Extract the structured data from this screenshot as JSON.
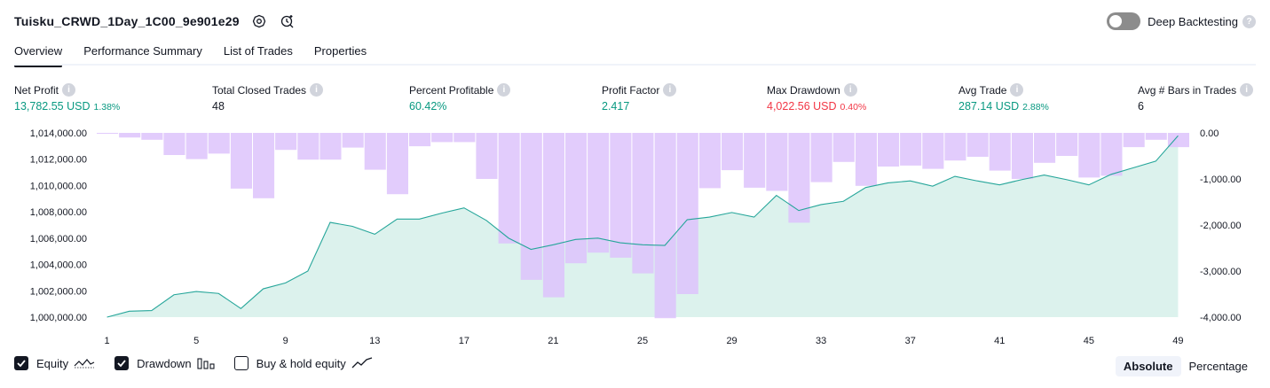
{
  "header": {
    "strategy_name": "Tuisku_CRWD_1Day_1C00_9e901e29",
    "deep_backtesting_label": "Deep Backtesting",
    "deep_backtesting_enabled": false
  },
  "tabs": [
    {
      "label": "Overview",
      "active": true
    },
    {
      "label": "Performance Summary",
      "active": false
    },
    {
      "label": "List of Trades",
      "active": false
    },
    {
      "label": "Properties",
      "active": false
    }
  ],
  "metrics": [
    {
      "label": "Net Profit",
      "value": "13,782.55 USD",
      "pct": "1.38%",
      "color": "green"
    },
    {
      "label": "Total Closed Trades",
      "value": "48",
      "pct": "",
      "color": "default"
    },
    {
      "label": "Percent Profitable",
      "value": "60.42%",
      "pct": "",
      "color": "green"
    },
    {
      "label": "Profit Factor",
      "value": "2.417",
      "pct": "",
      "color": "green"
    },
    {
      "label": "Max Drawdown",
      "value": "4,022.56 USD",
      "pct": "0.40%",
      "color": "red"
    },
    {
      "label": "Avg Trade",
      "value": "287.14 USD",
      "pct": "2.88%",
      "color": "green"
    },
    {
      "label": "Avg # Bars in Trades",
      "value": "6",
      "pct": "",
      "color": "default"
    }
  ],
  "colors": {
    "equity_line": "#26a69a",
    "equity_fill": "#d6f0ea",
    "drawdown_bar": "#ddc3fb",
    "green": "#089981",
    "red": "#f23645"
  },
  "chart_data": {
    "type": "area",
    "x": [
      1,
      2,
      3,
      4,
      5,
      6,
      7,
      8,
      9,
      10,
      11,
      12,
      13,
      14,
      15,
      16,
      17,
      18,
      19,
      20,
      21,
      22,
      23,
      24,
      25,
      26,
      27,
      28,
      29,
      30,
      31,
      32,
      33,
      34,
      35,
      36,
      37,
      38,
      39,
      40,
      41,
      42,
      43,
      44,
      45,
      46,
      47,
      48,
      49
    ],
    "x_ticks": [
      "1",
      "5",
      "9",
      "13",
      "17",
      "21",
      "25",
      "29",
      "33",
      "37",
      "41",
      "45",
      "49"
    ],
    "series": [
      {
        "name": "Equity",
        "axis": "left",
        "values": [
          1000000,
          1000450,
          1000500,
          1001700,
          1001950,
          1001800,
          1000650,
          1002150,
          1002600,
          1003500,
          1007200,
          1006900,
          1006300,
          1007450,
          1007450,
          1007900,
          1008300,
          1007350,
          1006000,
          1005150,
          1005500,
          1005900,
          1006000,
          1005650,
          1005500,
          1005450,
          1007400,
          1007600,
          1007950,
          1007600,
          1009250,
          1008100,
          1008550,
          1008800,
          1009850,
          1010200,
          1010350,
          1009950,
          1010700,
          1010350,
          1010050,
          1010450,
          1010800,
          1010450,
          1010050,
          1010850,
          1011350,
          1011850,
          1013782.55
        ]
      },
      {
        "name": "Drawdown",
        "axis": "right",
        "values": [
          0,
          -100,
          -150,
          -480,
          -570,
          -450,
          -1210,
          -1420,
          -370,
          -580,
          -580,
          -320,
          -800,
          -1330,
          -290,
          -200,
          -200,
          -1000,
          -2400,
          -3190,
          -3570,
          -2830,
          -2600,
          -2710,
          -3050,
          -4022.56,
          -3500,
          -1200,
          -810,
          -1190,
          -1260,
          -1950,
          -1070,
          -630,
          -1150,
          -730,
          -710,
          -780,
          -600,
          -520,
          -820,
          -1000,
          -650,
          -500,
          -970,
          -930,
          -310,
          -150,
          -310
        ]
      }
    ],
    "ylim_left": [
      1000000,
      1014000
    ],
    "ylim_right": [
      -4000,
      0
    ],
    "y_ticks_left": [
      "1,000,000.00",
      "1,002,000.00",
      "1,004,000.00",
      "1,006,000.00",
      "1,008,000.00",
      "1,010,000.00",
      "1,012,000.00",
      "1,014,000.00"
    ],
    "y_ticks_right": [
      "0.00",
      "-1,000.00",
      "-2,000.00",
      "-3,000.00",
      "-4,000.00"
    ]
  },
  "footer": {
    "checkboxes": [
      {
        "label": "Equity",
        "checked": true,
        "icon": "equity-line-icon"
      },
      {
        "label": "Drawdown",
        "checked": true,
        "icon": "drawdown-bars-icon"
      },
      {
        "label": "Buy & hold equity",
        "checked": false,
        "icon": "buy-hold-line-icon"
      }
    ],
    "modes": [
      {
        "label": "Absolute",
        "active": true
      },
      {
        "label": "Percentage",
        "active": false
      }
    ]
  }
}
